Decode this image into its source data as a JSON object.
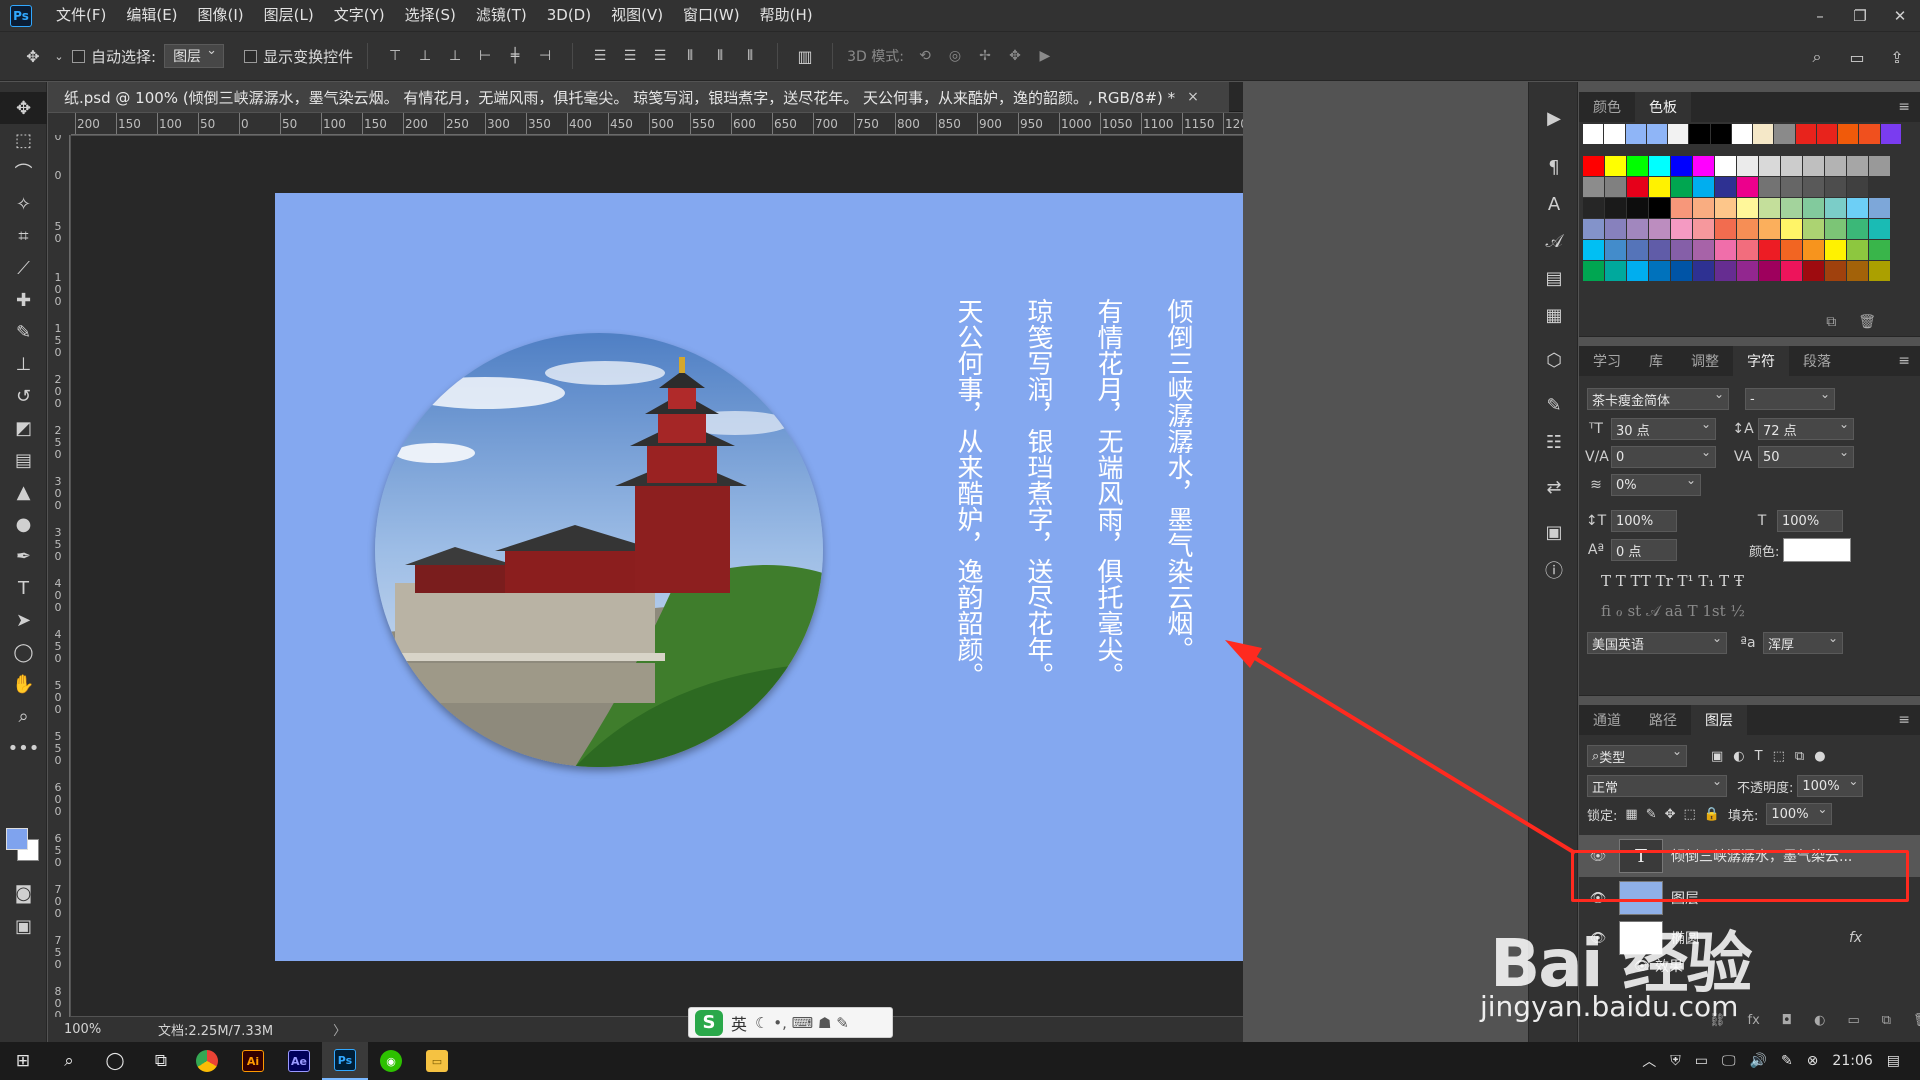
{
  "app": {
    "logo": "Ps"
  },
  "menu": [
    "文件(F)",
    "编辑(E)",
    "图像(I)",
    "图层(L)",
    "文字(Y)",
    "选择(S)",
    "滤镜(T)",
    "3D(D)",
    "视图(V)",
    "窗口(W)",
    "帮助(H)"
  ],
  "options": {
    "auto_select_label": "自动选择:",
    "auto_select_value": "图层",
    "show_transform_label": "显示变换控件",
    "mode3d_label": "3D 模式:"
  },
  "document": {
    "tab_title": "纸.psd @ 100% (倾倒三峡潺潺水，墨气染云烟。 有情花月，无端风雨，俱托毫尖。 琼笺写润，银珰煮字，送尽花年。 天公何事，从来酷妒，逸的韶颜。, RGB/8#) *",
    "close": "×"
  },
  "ruler_h": [
    "200",
    "150",
    "100",
    "50",
    "0",
    "50",
    "100",
    "150",
    "200",
    "250",
    "300",
    "350",
    "400",
    "450",
    "500",
    "550",
    "600",
    "650",
    "700",
    "750",
    "800",
    "850",
    "900",
    "950",
    "1000",
    "1050",
    "1100",
    "1150",
    "1200"
  ],
  "ruler_v": [
    "5\n0",
    "0",
    "5\n0",
    "1\n0\n0",
    "1\n5\n0",
    "2\n0\n0",
    "2\n5\n0",
    "3\n0\n0",
    "3\n5\n0",
    "4\n0\n0",
    "4\n5\n0",
    "5\n0\n0",
    "5\n5\n0",
    "6\n0\n0",
    "6\n5\n0",
    "7\n0\n0",
    "7\n5\n0",
    "8\n0\n0"
  ],
  "poem": {
    "col1": "倾倒三峡潺潺水，墨气染云烟。",
    "col2": "有情花月，无端风雨，俱托毫尖。",
    "col3": "琼笺写润，银珰煮字，送尽花年。",
    "col4": "天公何事，从来酷妒，逸韵韶颜。"
  },
  "status": {
    "zoom": "100%",
    "doc": "文档:2.25M/7.33M",
    "arrow": "〉"
  },
  "ime": {
    "logo": "S",
    "lang": "英",
    "symbols": "☾ •, ⌨ ☗ ✎"
  },
  "swatch_panel": {
    "tabs": [
      "颜色",
      "色板"
    ],
    "active": "色板"
  },
  "swatch_colors": [
    [
      "#ffffff",
      "#ffffff",
      "#8fb5f7",
      "#8fb5f7",
      "#f2f2f2",
      "#000000",
      "#000000",
      "#ffffff",
      "#f5e8c8",
      "#8a8a8a",
      "#e8231c",
      "#e8231c",
      "#f05a0a",
      "#f0501e",
      "#7a3cf0"
    ],
    [
      "#ff0000",
      "#ffff00",
      "#00ff00",
      "#00ffff",
      "#0000ff",
      "#ff00ff",
      "#ffffff",
      "#ebebeb",
      "#d9d9d9",
      "#cccccc",
      "#bfbfbf",
      "#b3b3b3",
      "#a6a6a6",
      "#999999"
    ],
    [
      "#8c8c8c",
      "#808080",
      "#e6001a",
      "#fff200",
      "#00a650",
      "#00aeef",
      "#2e3192",
      "#ec008c",
      "#737373",
      "#666666",
      "#595959",
      "#4d4d4d",
      "#404040",
      "#333333"
    ],
    [
      "#262626",
      "#1a1a1a",
      "#0d0d0d",
      "#000000",
      "#f7977a",
      "#f9ad81",
      "#fdc68a",
      "#fff79a",
      "#c4df9b",
      "#a3d39c",
      "#82ca9d",
      "#7bcdc8",
      "#6dcff6",
      "#7da7d9"
    ],
    [
      "#8393ca",
      "#8781bd",
      "#a187be",
      "#bc8dbf",
      "#f49ac2",
      "#f6989d",
      "#f26c4f",
      "#f68e55",
      "#fbaf5c",
      "#fff467",
      "#acd372",
      "#7cc576",
      "#3bb878",
      "#1abbb4"
    ],
    [
      "#00bff3",
      "#438ccb",
      "#5574b9",
      "#605ca8",
      "#855fa8",
      "#a763a8",
      "#f06eaa",
      "#f26d7d",
      "#ed1c24",
      "#f26522",
      "#f7941d",
      "#fff200",
      "#8dc73f",
      "#39b54a"
    ],
    [
      "#00a651",
      "#00a99d",
      "#00aeef",
      "#0072bc",
      "#0054a6",
      "#2e3192",
      "#662d91",
      "#92278f",
      "#9e005d",
      "#ed145b",
      "#9e0b0f",
      "#a0410d",
      "#a36209",
      "#aba000"
    ]
  ],
  "char_panel": {
    "tabs": [
      "学习",
      "库",
      "调整",
      "字符",
      "段落"
    ],
    "active": "字符",
    "font": "茶卡瘦金简体",
    "style": "-",
    "size": "30 点",
    "leading": "72 点",
    "kerning": "0",
    "tracking": "50",
    "scale_pct": "0%",
    "vscale": "100%",
    "hscale": "100%",
    "baseline": "0 点",
    "color_label": "颜色:",
    "style_buttons": "T T TT Tr T¹ T₁ T Ŧ",
    "ot_buttons": "ﬁ ℴ st 𝒜 aā T 1st ½",
    "language": "美国英语",
    "aa_label": "ªa",
    "aa_value": "浑厚"
  },
  "layer_panel": {
    "tabs": [
      "通道",
      "路径",
      "图层"
    ],
    "active": "图层",
    "filter": "类型",
    "blend": "正常",
    "opacity_label": "不透明度:",
    "opacity": "100%",
    "lock_label": "锁定:",
    "fill_label": "填充:",
    "fill": "100%",
    "layers": [
      {
        "name": "倾倒三峡潺潺水，墨气染云...",
        "thumb": "T"
      },
      {
        "name": "图层",
        "thumb": ""
      },
      {
        "name": "椭圆",
        "thumb": ""
      },
      {
        "name": "效果",
        "thumb": ""
      }
    ],
    "fx": "fx"
  },
  "taskbar": {
    "time": "21:06"
  },
  "watermark": {
    "text": "Bai 经验",
    "url": "jingyan.baidu.com"
  }
}
